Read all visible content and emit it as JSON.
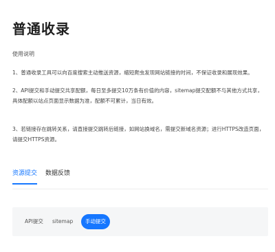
{
  "page": {
    "title": "普通收录"
  },
  "usage": {
    "heading": "使用说明",
    "notes": [
      "1、普通收录工具可以向百度搜索主动推送资源，缩短爬虫发现网站链接的时间，不保证收录和展现效果。",
      "2、API提交和手动提交共享配额，每日至多提交10万条有价值的内容，sitemap提交配额不与其他方式共享，具体配额以站点页面显示数据为准，配额不可累计，当日有效。",
      "3、若链接存在跳转关系，请直接提交跳转后链接，如网站换域名，需提交新域名资源；进行HTTPS改造页面，请提交HTTPS资源。"
    ]
  },
  "tabs": [
    {
      "label": "资源提交",
      "active": true
    },
    {
      "label": "数据反馈",
      "active": false
    }
  ],
  "submit_methods": [
    {
      "label": "API提交",
      "active": false
    },
    {
      "label": "sitemap",
      "active": false
    },
    {
      "label": "手动提交",
      "active": true
    }
  ],
  "colors": {
    "accent": "#1677ff",
    "panel_bg": "#f5f6f7"
  }
}
